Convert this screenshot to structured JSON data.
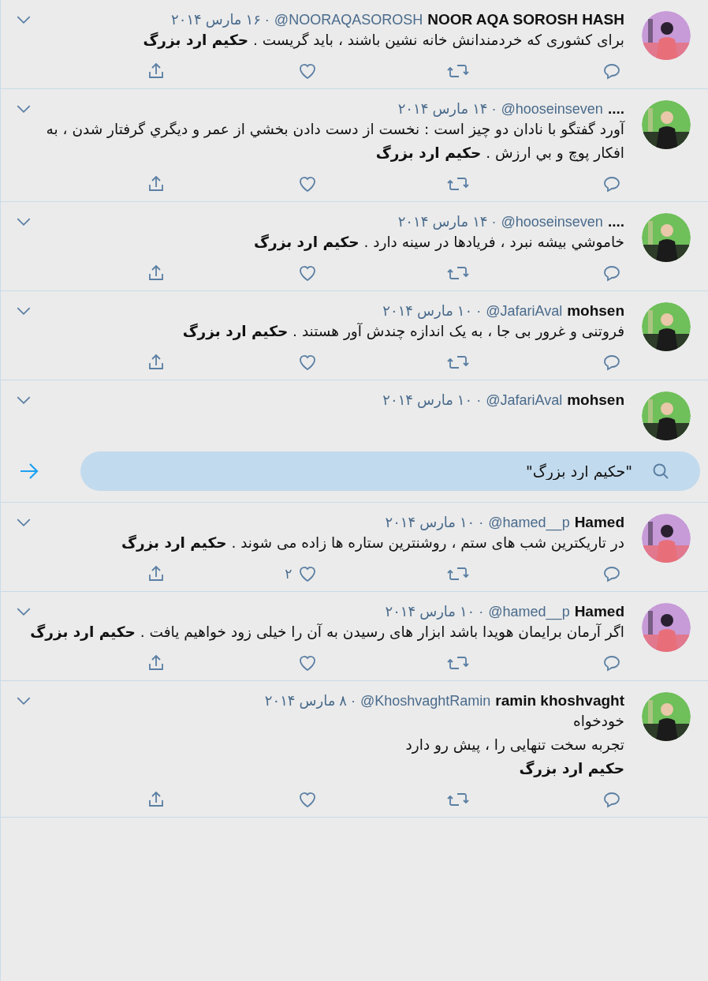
{
  "tweets_above": [
    {
      "name": "NOOR AQA SOROSH HASH",
      "handle": "@NOORAQASOROSH",
      "date": "· ۱۶ مارس ۲۰۱۴",
      "lines": [
        "برای کشوری که خردمندانش خانه نشین باشند ، باید گریست .  **حکیم ارد بزرگ**"
      ]
    },
    {
      "name": "....",
      "handle": "@hooseinseven",
      "date": "· ۱۴ مارس ۲۰۱۴",
      "lines": [
        "آورد گفتگو با نادان دو چیز است : نخست از دست دادن بخشي از عمر و دیگري گرفتار شدن ، به افکار پوچ و بي ارزش . **حکیم ارد بزرگ**"
      ]
    },
    {
      "name": "....",
      "handle": "@hooseinseven",
      "date": "· ۱۴ مارس ۲۰۱۴",
      "lines": [
        "خاموشي بیشه نبرد ، فریادها در سینه دارد . **حکیم ارد بزرگ**"
      ]
    },
    {
      "name": "mohsen",
      "handle": "@JafariAval",
      "date": "· ۱۰ مارس ۲۰۱۴",
      "lines": [
        "فروتنی و غرور بی جا ، به یک اندازه چندش آور هستند . **حکیم ارد بزرگ**"
      ]
    },
    {
      "name": "mohsen",
      "handle": "@JafariAval",
      "date": "· ۱۰ مارس ۲۰۱۴"
    }
  ],
  "search": {
    "value": "\"حکیم ارد بزرگ\""
  },
  "tweets_below": [
    {
      "name": "Hamed",
      "handle": "@hamed__p",
      "date": "· ۱۰ مارس ۲۰۱۴",
      "lines": [
        "در تاریکترین شب های ستم ، روشنترین ستاره ها زاده می شوند . **حکیم ارد بزرگ**"
      ],
      "likes": "۲"
    },
    {
      "name": "Hamed",
      "handle": "@hamed__p",
      "date": "· ۱۰ مارس ۲۰۱۴",
      "lines": [
        "اگر آرمان برایمان هویدا باشد ابزار های رسیدن به آن را خیلی زود خواهیم یافت . **حکیم ارد بزرگ**"
      ]
    },
    {
      "name": "ramin khoshvaght",
      "handle": "@KhoshvaghtRamin",
      "date": "· ۸ مارس ۲۰۱۴",
      "lines": [
        "خودخواه",
        "تجربه سخت تنهایی را ، پیش رو دارد",
        "**حکیم ارد بزرگ**"
      ]
    }
  ]
}
